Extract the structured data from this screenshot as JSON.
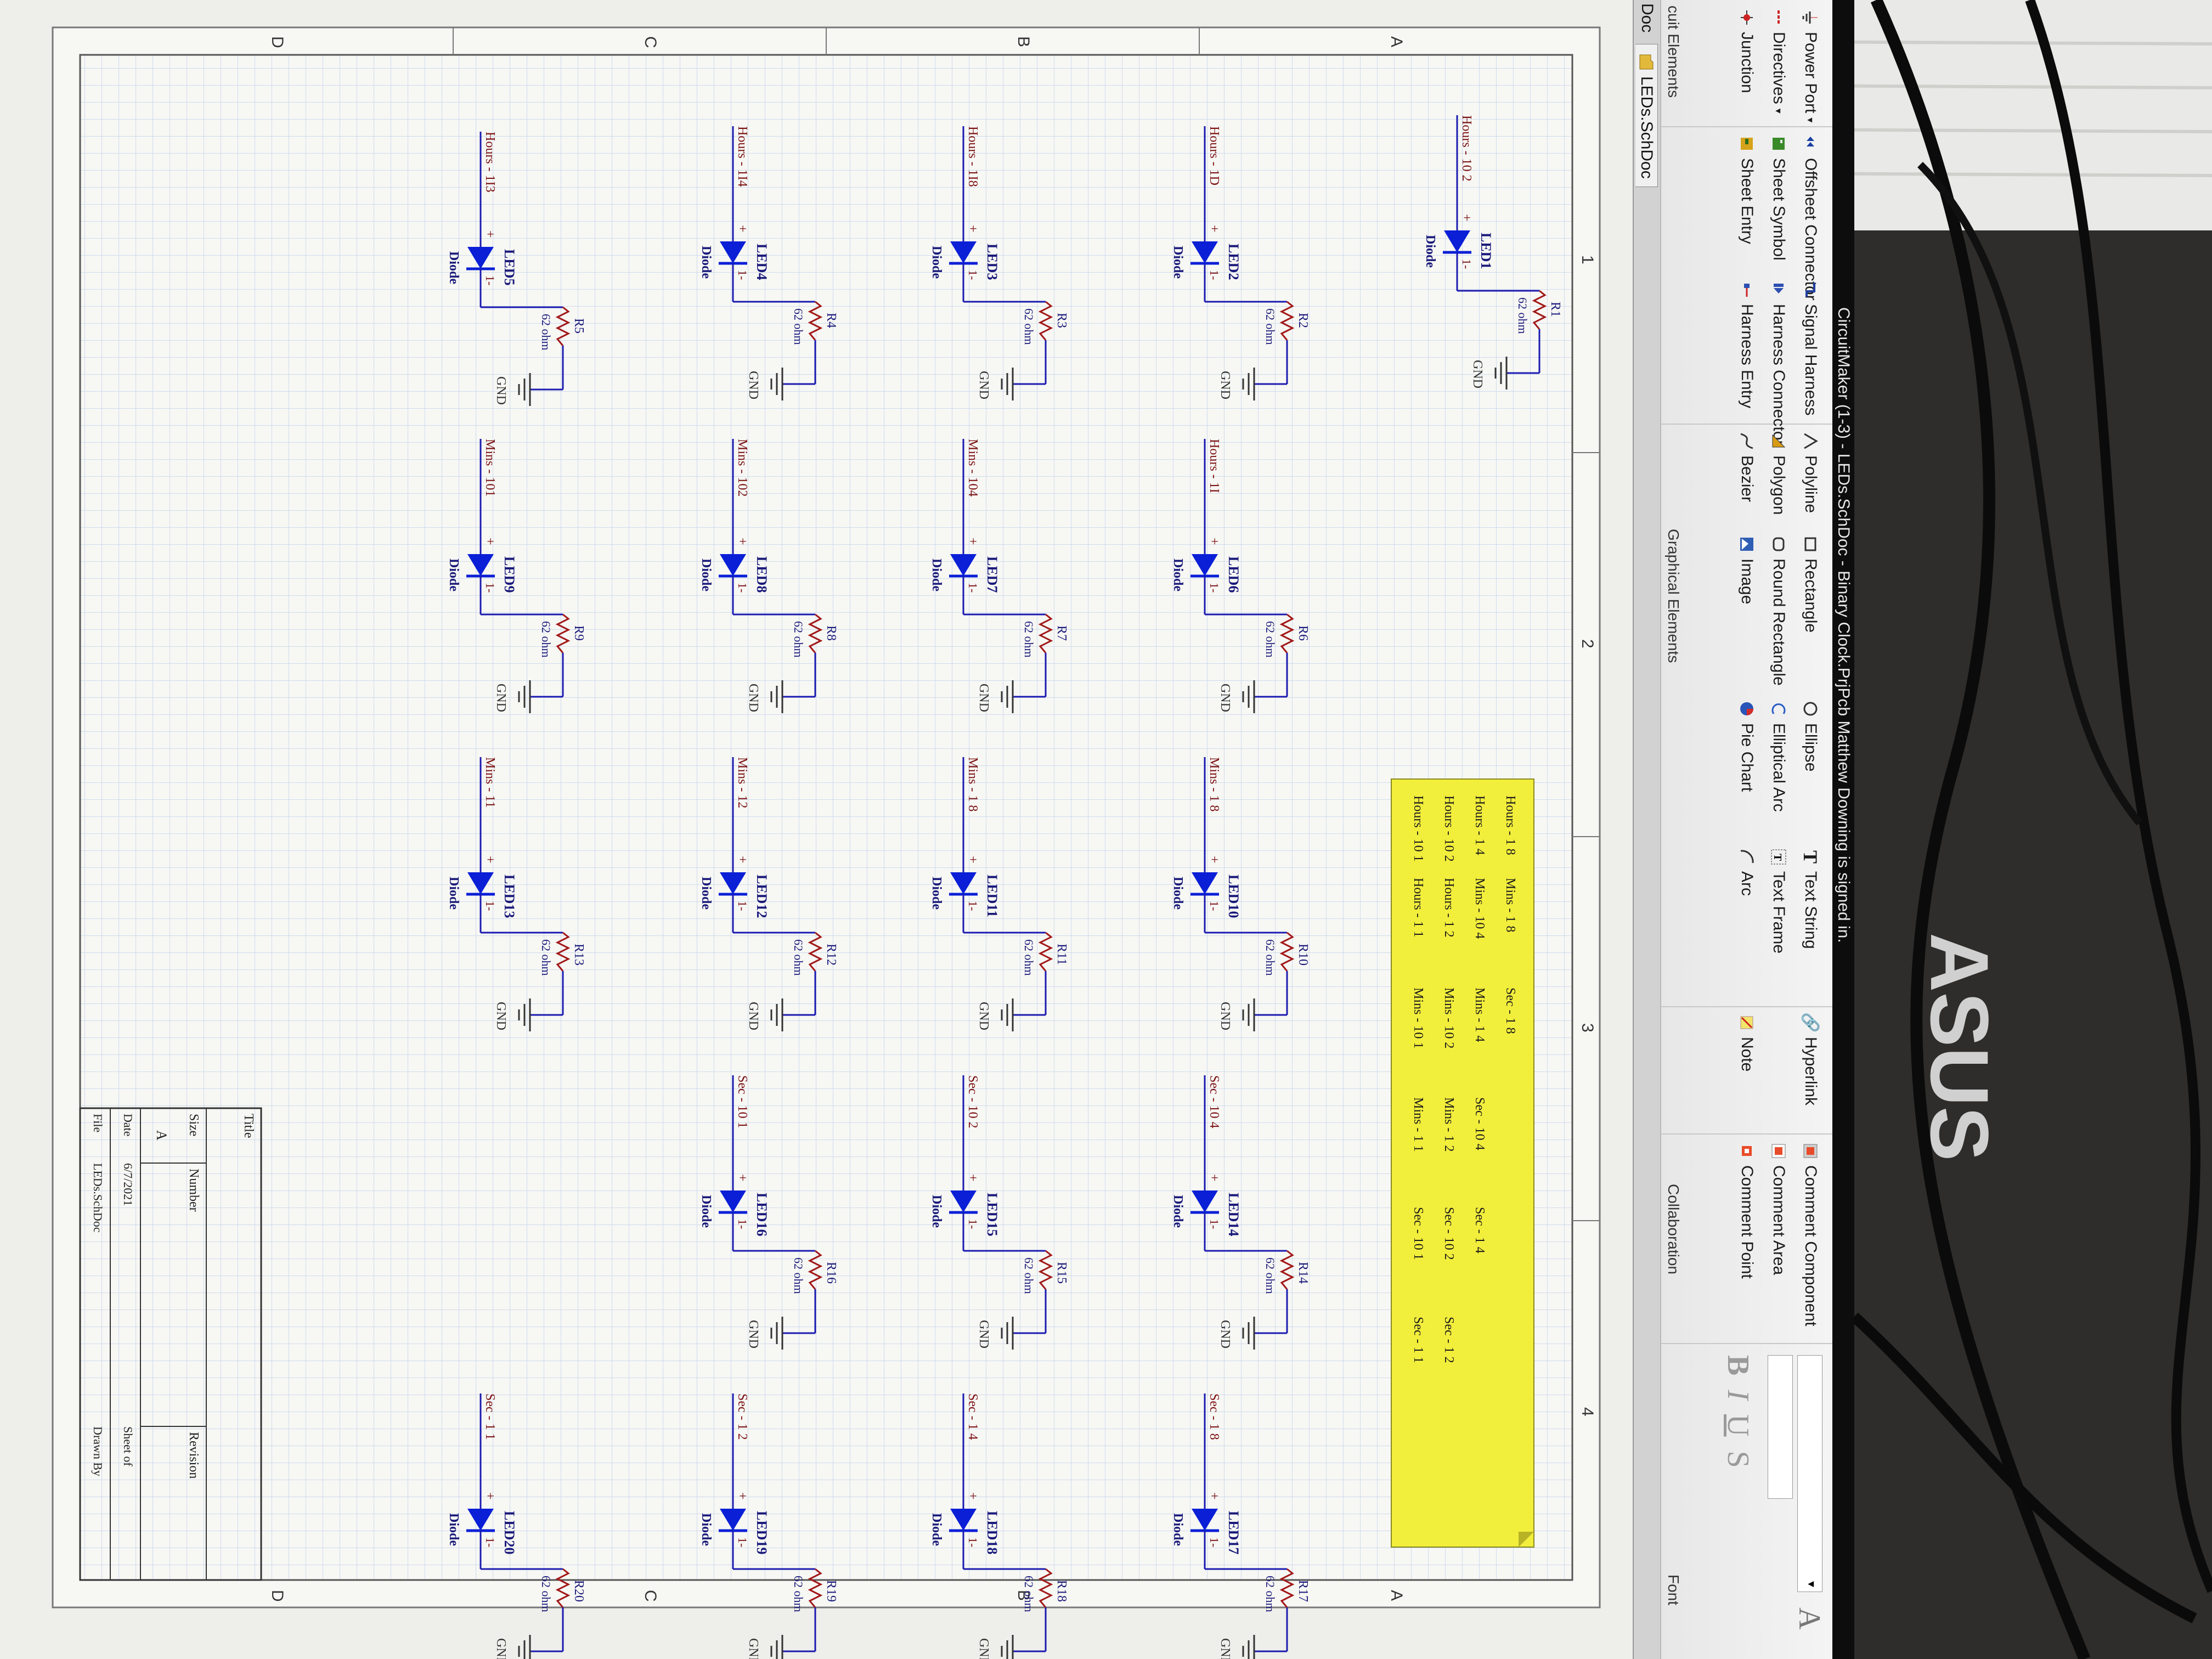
{
  "window": {
    "title": "CircuitMaker (1-3) - LEDs.SchDoc - Binary Clock.PrjPcb Matthew Downing is signed in."
  },
  "ribbon": {
    "circuit_elements": {
      "items": [
        "Power Port",
        "Directives",
        "Junction"
      ],
      "label": "cuit Elements"
    },
    "sheet": {
      "items": [
        "Offsheet Connector",
        "Sheet Symbol",
        "Sheet Entry",
        "Signal Harness",
        "Harness Connector",
        "Harness Entry"
      ]
    },
    "graphical_elements": {
      "items": [
        "Polyline",
        "Polygon",
        "Bezier",
        "Rectangle",
        "Round Rectangle",
        "Image",
        "Ellipse",
        "Elliptical Arc",
        "Pie Chart",
        "Text String",
        "Text Frame",
        "Arc",
        "Hyperlink",
        "Note"
      ],
      "label": "Graphical Elements"
    },
    "collaboration": {
      "items": [
        "Comment Component",
        "Comment Area",
        "Comment Point"
      ],
      "label": "Collaboration"
    },
    "font": {
      "bold": "B",
      "italic": "I",
      "underline": "U",
      "strike": "S",
      "size_glyph": "A",
      "label": "Font"
    }
  },
  "tabs": {
    "prev": "Doc",
    "active": "LEDs.SchDoc"
  },
  "schematic": {
    "grid_cols": [
      "1",
      "2",
      "3",
      "4"
    ],
    "grid_rows": [
      "A",
      "B",
      "C",
      "D"
    ],
    "part_value": "Diode",
    "resistor_value": "62 ohm",
    "ground_label": "GND",
    "anode_suffix": "+",
    "cathode_label": "1-",
    "leds": [
      {
        "ref": "LED1",
        "net": "Hours - 10 2",
        "res": "R1"
      },
      {
        "ref": "LED2",
        "net": "Hours - 1D",
        "res": "R2"
      },
      {
        "ref": "LED3",
        "net": "Hours - 1I8",
        "res": "R3"
      },
      {
        "ref": "LED4",
        "net": "Hours - 1I4",
        "res": "R4"
      },
      {
        "ref": "LED5",
        "net": "Hours - 1I3",
        "res": "R5"
      },
      {
        "ref": "LED6",
        "net": "Hours - 1I",
        "res": "R6"
      },
      {
        "ref": "LED7",
        "net": "Mins - 104",
        "res": "R7"
      },
      {
        "ref": "LED8",
        "net": "Mins - 102",
        "res": "R8"
      },
      {
        "ref": "LED9",
        "net": "Mins - 101",
        "res": "R9"
      },
      {
        "ref": "LED10",
        "net": "Mins - 1 8",
        "res": "R10"
      },
      {
        "ref": "LED11",
        "net": "Mins - 1 8",
        "res": "R11"
      },
      {
        "ref": "LED12",
        "net": "Mins - 12",
        "res": "R12"
      },
      {
        "ref": "LED13",
        "net": "Mins - 11",
        "res": "R13"
      },
      {
        "ref": "LED14",
        "net": "Sec - 10 4",
        "res": "R14"
      },
      {
        "ref": "LED15",
        "net": "Sec - 10 2",
        "res": "R15"
      },
      {
        "ref": "LED16",
        "net": "Sec - 10 1",
        "res": "R16"
      },
      {
        "ref": "LED17",
        "net": "Sec - 1 8",
        "res": "R17"
      },
      {
        "ref": "LED18",
        "net": "Sec - 1 4",
        "res": "R18"
      },
      {
        "ref": "LED19",
        "net": "Sec - 1 2",
        "res": "R19"
      },
      {
        "ref": "LED20",
        "net": "Sec - 1 1",
        "res": "R20"
      }
    ],
    "note": {
      "rows": [
        [
          "Hours - 1 8",
          "Mins - 1 8",
          "Sec - 1 8"
        ],
        [
          "Hours - 1 4",
          "Mins - 10 4",
          "Mins - 1 4",
          "Sec - 10 4",
          "Sec - 1 4"
        ],
        [
          "Hours - 10 2",
          "Hours - 1 2",
          "Mins - 10 2",
          "Mins - 1 2",
          "Sec - 10 2",
          "Sec - 1 2"
        ],
        [
          "Hours - 10 1",
          "Hours - 1 1",
          "Mins - 10 1",
          "Mins - 1 1",
          "Sec - 10 1",
          "Sec - 1 1"
        ]
      ]
    },
    "title_block": {
      "title_label": "Title",
      "size_label": "Size",
      "size_value": "A",
      "number_label": "Number",
      "revision_label": "Revision",
      "date_label": "Date",
      "date_value": "6/7/2021",
      "file_label": "File",
      "file_value": "LEDs.SchDoc",
      "sheet_label": "Sheet   of",
      "drawn_label": "Drawn By"
    }
  },
  "monitor": {
    "brand": "ASUS"
  },
  "colors": {
    "diode": "#0a1fd6",
    "wire": "#1b1bb0",
    "resistor": "#a11818",
    "net_text": "#7a1010",
    "note_fill": "#f2ee3c",
    "grid": "#c4d3ea"
  }
}
